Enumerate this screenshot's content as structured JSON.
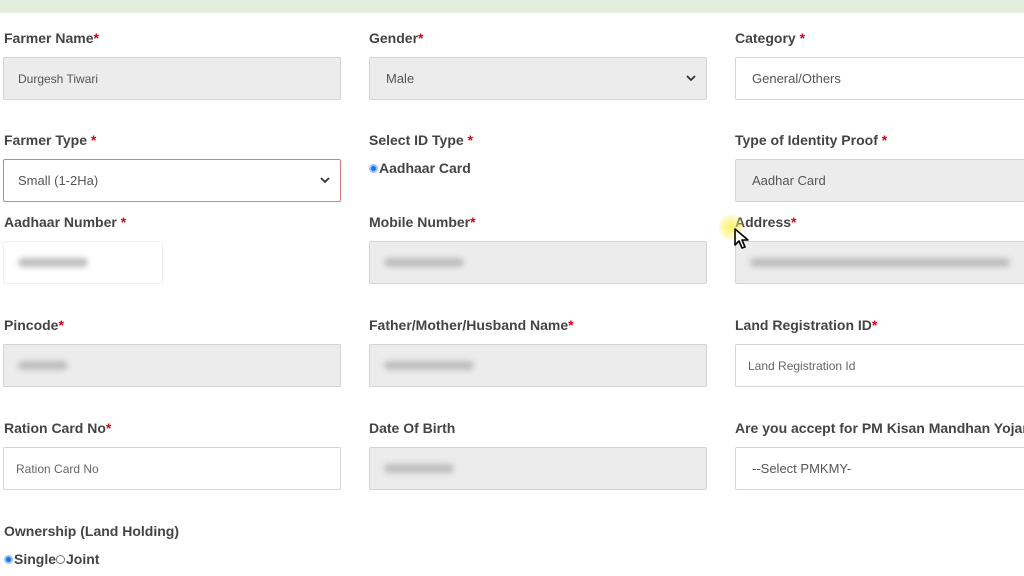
{
  "form": {
    "farmer_name": {
      "label": "Farmer Name",
      "req": "*",
      "value": "Durgesh Tiwari"
    },
    "gender": {
      "label": "Gender",
      "req": "*",
      "value": "Male"
    },
    "category": {
      "label": "Category",
      "req": "*",
      "value": "General/Others"
    },
    "farmer_type": {
      "label": "Farmer Type",
      "req": "*",
      "value": "Small (1-2Ha)"
    },
    "select_id_type": {
      "label": "Select ID Type",
      "req": "*",
      "option": "Aadhaar Card"
    },
    "identity_proof": {
      "label": "Type of Identity Proof",
      "req": "*",
      "value": "Aadhar Card"
    },
    "aadhaar_number": {
      "label": "Aadhaar Number",
      "req": "*"
    },
    "mobile_number": {
      "label": "Mobile Number",
      "req": "*"
    },
    "address": {
      "label": "Address",
      "req": "*"
    },
    "pincode": {
      "label": "Pincode",
      "req": "*"
    },
    "father_name": {
      "label": "Father/Mother/Husband Name",
      "req": "*"
    },
    "land_registration": {
      "label": "Land Registration ID",
      "req": "*",
      "placeholder": "Land Registration Id"
    },
    "ration_card": {
      "label": "Ration Card No",
      "req": "*",
      "placeholder": "Ration Card No"
    },
    "dob": {
      "label": "Date Of Birth"
    },
    "pmkmy": {
      "label": "Are you accept for PM Kisan Mandhan Yojana",
      "value": "--Select PMKMY-"
    },
    "ownership": {
      "label": "Ownership (Land Holding)",
      "option_single": "Single",
      "option_joint": "Joint"
    }
  },
  "icons": {
    "select_arrow": "chevron-down-icon",
    "radio": "radio-icon",
    "cursor": "mouse-cursor-icon"
  },
  "colors": {
    "required": "#d0021b",
    "error_border": "#e07a7a",
    "radio_selected": "#1a73e8",
    "top_bar": "#e4eedc"
  }
}
